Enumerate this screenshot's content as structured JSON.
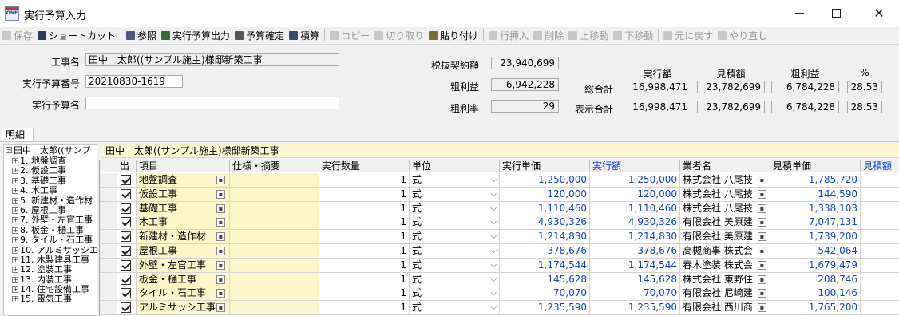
{
  "window": {
    "title": "実行予算入力",
    "app_icon_text": "ONE"
  },
  "toolbar": {
    "items": [
      {
        "label": "保存",
        "icon": "save-icon",
        "enabled": false,
        "color": "#6b7a99"
      },
      {
        "label": "ショートカット",
        "icon": "shortcut-icon",
        "enabled": true,
        "color": "#2f3b5a"
      },
      {
        "label": "参照",
        "icon": "reference-icon",
        "enabled": true,
        "color": "#4a5a80"
      },
      {
        "label": "実行予算出力",
        "icon": "output-icon",
        "enabled": true,
        "color": "#3a6a3a"
      },
      {
        "label": "予算確定",
        "icon": "lock-icon",
        "enabled": true,
        "color": "#555555"
      },
      {
        "label": "積算",
        "icon": "calc-icon",
        "enabled": true,
        "color": "#3a4a6a"
      },
      {
        "label": "コピー",
        "icon": "copy-icon",
        "enabled": false,
        "color": "#888888"
      },
      {
        "label": "切り取り",
        "icon": "cut-icon",
        "enabled": false,
        "color": "#888888"
      },
      {
        "label": "貼り付け",
        "icon": "paste-icon",
        "enabled": true,
        "color": "#7a6a3a"
      },
      {
        "label": "行挿入",
        "icon": "insert-row-icon",
        "enabled": false,
        "color": "#888888"
      },
      {
        "label": "削除",
        "icon": "delete-icon",
        "enabled": false,
        "color": "#888888"
      },
      {
        "label": "上移動",
        "icon": "move-up-icon",
        "enabled": false,
        "color": "#888888"
      },
      {
        "label": "下移動",
        "icon": "move-down-icon",
        "enabled": false,
        "color": "#888888"
      },
      {
        "label": "元に戻す",
        "icon": "undo-icon",
        "enabled": false,
        "color": "#888888"
      },
      {
        "label": "やり直し",
        "icon": "redo-icon",
        "enabled": false,
        "color": "#888888"
      }
    ]
  },
  "header": {
    "project_label": "工事名",
    "project_value": "田中　太郎((サンプル施主)様邸新築工事",
    "budget_no_label": "実行予算番号",
    "budget_no_value": "20210830-1619",
    "budget_name_label": "実行予算名",
    "budget_name_value": ""
  },
  "summary": {
    "contract_label": "税抜契約額",
    "contract_value": "23,940,699",
    "gross_profit_label": "粗利益",
    "gross_profit_value": "6,942,228",
    "gross_rate_label": "粗利率",
    "gross_rate_value": "29",
    "columns": [
      "実行額",
      "見積額",
      "粗利益",
      "%"
    ],
    "total_label": "総合計",
    "total_values": [
      "16,998,471",
      "23,782,699",
      "6,784,228",
      "28.53"
    ],
    "display_label": "表示合計",
    "display_values": [
      "16,998,471",
      "23,782,699",
      "6,784,228",
      "28.53"
    ]
  },
  "tabs": {
    "meisai": "明細"
  },
  "tree": {
    "root": "田中　太郎((サンプ",
    "nodes": [
      "1. 地盤調査",
      "2. 仮設工事",
      "3. 基礎工事",
      "4. 木工事",
      "5. 新建材・造作材",
      "6. 屋根工事",
      "7. 外壁・左官工事",
      "8. 板金・樋工事",
      "9. タイル・石工事",
      "10. アルミサッシエ",
      "11. 木製建具工事",
      "12. 塗装工事",
      "13. 内装工事",
      "14. 住宅設備工事",
      "15. 電気工事"
    ]
  },
  "grid": {
    "title": "田中　太郎((サンプル施主)様邸新築工事",
    "headers": [
      "出",
      "項目",
      "仕様・摘要",
      "実行数量",
      "単位",
      "実行単価",
      "実行額",
      "業者名",
      "見積単価",
      "見積額"
    ],
    "rows": [
      {
        "item": "地盤調査",
        "spec": "",
        "qty": "1",
        "unit": "式",
        "unit_price": "1,250,000",
        "amount": "1,250,000",
        "vendor": "株式会社 八尾技",
        "est_price": "1,785,720",
        "est_amount": ""
      },
      {
        "item": "仮設工事",
        "spec": "",
        "qty": "1",
        "unit": "式",
        "unit_price": "120,000",
        "amount": "120,000",
        "vendor": "株式会社 八尾技",
        "est_price": "144,590",
        "est_amount": ""
      },
      {
        "item": "基礎工事",
        "spec": "",
        "qty": "1",
        "unit": "式",
        "unit_price": "1,110,460",
        "amount": "1,110,460",
        "vendor": "株式会社 八尾技",
        "est_price": "1,338,103",
        "est_amount": ""
      },
      {
        "item": "木工事",
        "spec": "",
        "qty": "1",
        "unit": "式",
        "unit_price": "4,930,326",
        "amount": "4,930,326",
        "vendor": "有限会社 美原建",
        "est_price": "7,047,131",
        "est_amount": ""
      },
      {
        "item": "新建材・造作材",
        "spec": "",
        "qty": "1",
        "unit": "式",
        "unit_price": "1,214,830",
        "amount": "1,214,830",
        "vendor": "有限会社 美原建",
        "est_price": "1,739,200",
        "est_amount": ""
      },
      {
        "item": "屋根工事",
        "spec": "",
        "qty": "1",
        "unit": "式",
        "unit_price": "378,676",
        "amount": "378,676",
        "vendor": "高槻商事 株式会",
        "est_price": "542,064",
        "est_amount": ""
      },
      {
        "item": "外壁・左官工事",
        "spec": "",
        "qty": "1",
        "unit": "式",
        "unit_price": "1,174,544",
        "amount": "1,174,544",
        "vendor": "春木塗装 株式会",
        "est_price": "1,679,479",
        "est_amount": ""
      },
      {
        "item": "板金・樋工事",
        "spec": "",
        "qty": "1",
        "unit": "式",
        "unit_price": "145,628",
        "amount": "145,628",
        "vendor": "株式会社 東野住",
        "est_price": "208,746",
        "est_amount": ""
      },
      {
        "item": "タイル・石工事",
        "spec": "",
        "qty": "1",
        "unit": "式",
        "unit_price": "70,070",
        "amount": "70,070",
        "vendor": "有限会社 尼崎建",
        "est_price": "100,146",
        "est_amount": ""
      },
      {
        "item": "アルミサッシ工事",
        "spec": "",
        "qty": "1",
        "unit": "式",
        "unit_price": "1,235,590",
        "amount": "1,235,590",
        "vendor": "有限会社 西川商",
        "est_price": "1,765,200",
        "est_amount": ""
      }
    ]
  },
  "colors": {
    "blue_text": "#1240d8",
    "yellow_cell": "#fdf6c8",
    "title_band": "#fdf8d2"
  }
}
